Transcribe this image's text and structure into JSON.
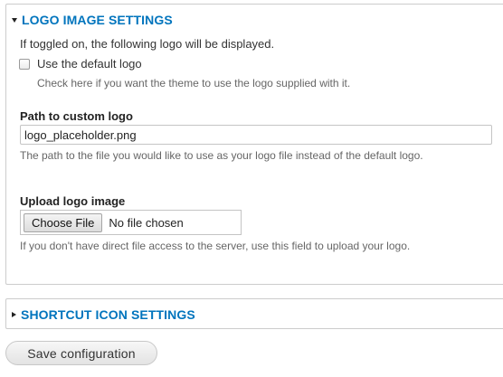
{
  "logo_settings": {
    "legend": "LOGO IMAGE SETTINGS",
    "description": "If toggled on, the following logo will be displayed.",
    "default_logo": {
      "label": "Use the default logo",
      "checked": false,
      "help": "Check here if you want the theme to use the logo supplied with it."
    },
    "path": {
      "label": "Path to custom logo",
      "value": "logo_placeholder.png",
      "help": "The path to the file you would like to use as your logo file instead of the default logo."
    },
    "upload": {
      "label": "Upload logo image",
      "button": "Choose File",
      "status": "No file chosen",
      "help": "If you don't have direct file access to the server, use this field to upload your logo."
    }
  },
  "shortcut_settings": {
    "legend": "SHORTCUT ICON SETTINGS"
  },
  "actions": {
    "save": "Save configuration"
  },
  "colors": {
    "link": "#0074bd",
    "border": "#cccccc"
  }
}
